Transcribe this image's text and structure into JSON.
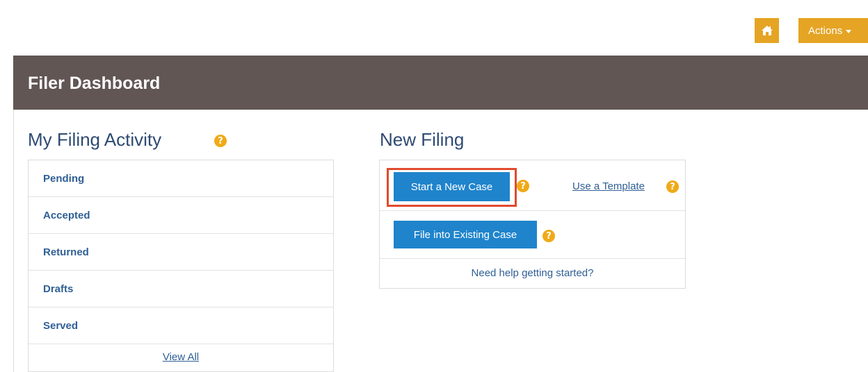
{
  "topbar": {
    "home_icon": "home-icon",
    "actions_label": "Actions",
    "accent_color": "#e5a423"
  },
  "header": {
    "title": "Filer Dashboard",
    "background_color": "#615654"
  },
  "activity": {
    "title": "My Filing Activity",
    "help": "?",
    "items": [
      {
        "label": "Pending"
      },
      {
        "label": "Accepted"
      },
      {
        "label": "Returned"
      },
      {
        "label": "Drafts"
      },
      {
        "label": "Served"
      }
    ],
    "view_all": "View All"
  },
  "new_filing": {
    "title": "New Filing",
    "start_new_case": "Start a New Case",
    "use_template": "Use a Template",
    "file_existing": "File into Existing Case",
    "need_help": "Need help getting started?",
    "help": "?",
    "button_color": "#1f84cc",
    "highlight_color": "#e14a2e"
  }
}
